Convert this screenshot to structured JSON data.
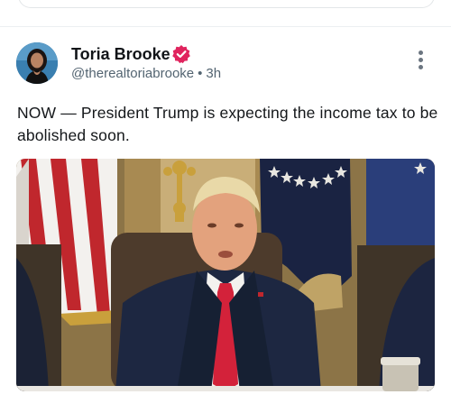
{
  "post": {
    "author_name": "Toria Brooke",
    "handle": "@therealtoriabrooke",
    "separator": "•",
    "time": "3h",
    "text": "NOW — President Trump is expecting the income tax to be abolished soon."
  },
  "icons": {
    "verified": "verified-badge-icon",
    "more": "more-vertical-icon"
  },
  "colors": {
    "verified_badge": "#e0245e",
    "handle": "#536471",
    "text": "#14171a"
  }
}
